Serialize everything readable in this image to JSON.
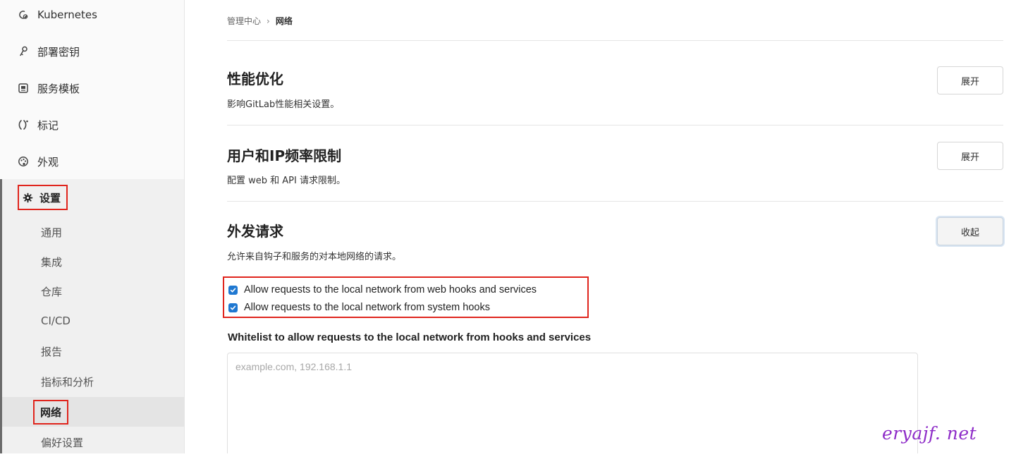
{
  "sidebar": {
    "items": [
      {
        "label": "Kubernetes",
        "icon": "kubernetes-icon"
      },
      {
        "label": "部署密钥",
        "icon": "key-icon"
      },
      {
        "label": "服务模板",
        "icon": "template-icon"
      },
      {
        "label": "标记",
        "icon": "labels-icon"
      },
      {
        "label": "外观",
        "icon": "appearance-icon"
      }
    ],
    "settings": {
      "label": "设置",
      "icon": "gear-icon",
      "items": [
        {
          "label": "通用"
        },
        {
          "label": "集成"
        },
        {
          "label": "仓库"
        },
        {
          "label": "CI/CD"
        },
        {
          "label": "报告"
        },
        {
          "label": "指标和分析"
        },
        {
          "label": "网络",
          "active": true
        },
        {
          "label": "偏好设置"
        }
      ]
    }
  },
  "breadcrumb": {
    "parent": "管理中心",
    "separator": "›",
    "current": "网络"
  },
  "sections": [
    {
      "title": "性能优化",
      "description": "影响GitLab性能相关设置。",
      "button": "展开"
    },
    {
      "title": "用户和IP频率限制",
      "description": "配置 web 和 API 请求限制。",
      "button": "展开"
    },
    {
      "title": "外发请求",
      "description": "允许来自钩子和服务的对本地网络的请求。",
      "button": "收起",
      "checkboxes": [
        {
          "label": "Allow requests to the local network from web hooks and services",
          "checked": true
        },
        {
          "label": "Allow requests to the local network from system hooks",
          "checked": true
        }
      ],
      "whitelist": {
        "label": "Whitelist to allow requests to the local network from hooks and services",
        "placeholder": "example.com, 192.168.1.1",
        "value": ""
      }
    }
  ],
  "watermark": "eryajf. net",
  "colors": {
    "highlight": "#e0251d",
    "checkbox": "#1f78d1",
    "watermark": "#8e2cc8"
  }
}
